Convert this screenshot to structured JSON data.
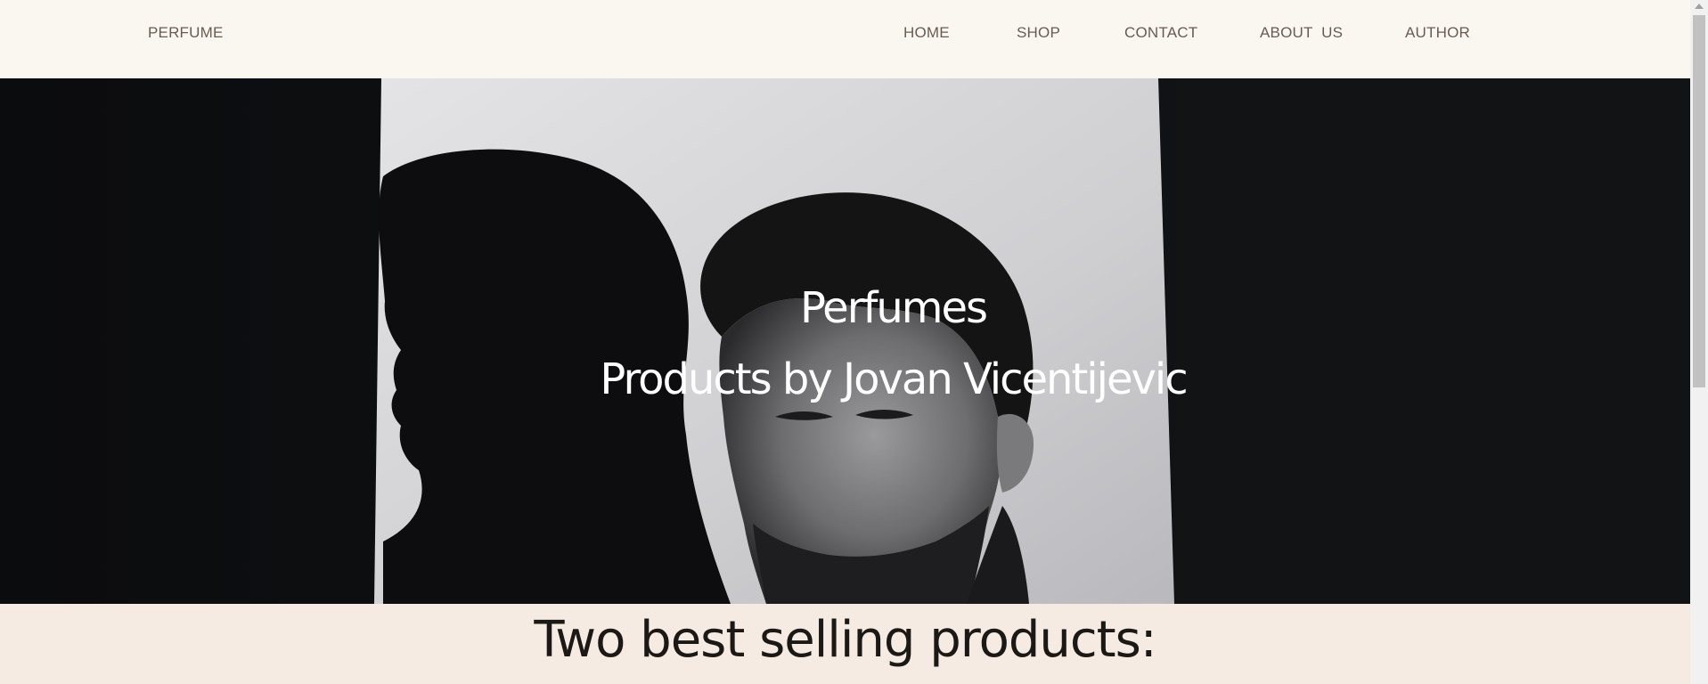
{
  "header": {
    "brand": "PERFUME",
    "nav": {
      "home": "HOME",
      "shop": "SHOP",
      "contact": "CONTACT",
      "about": "ABOUT  US",
      "author": "AUTHOR"
    }
  },
  "hero": {
    "title": "Perfumes",
    "subtitle": "Products by Jovan Vicentijevic",
    "image": "black-and-white portrait of a man with his shadow on a lit wall"
  },
  "bestsellers": {
    "title": "Two best selling products:"
  },
  "colors": {
    "header_bg": "#faf7f1",
    "nav_text": "#6a5a52",
    "hero_bg": "#0f1012",
    "section_bg": "#f5ebe2",
    "section_text": "#1b1816"
  }
}
